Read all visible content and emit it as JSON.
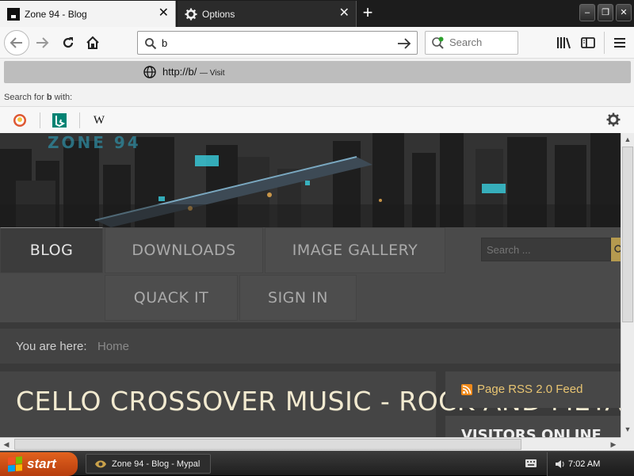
{
  "browser": {
    "tabs": [
      {
        "title": "Zone 94 - Blog",
        "active": true
      },
      {
        "title": "Options",
        "active": false
      }
    ],
    "new_tab_label": "+",
    "window_controls": {
      "minimize": "–",
      "maximize": "❐",
      "close": "✕"
    },
    "url_value": "b",
    "search_placeholder": "Search",
    "dropdown": {
      "suggestion_url": "http://b/",
      "suggestion_action": "— Visit",
      "search_for_prefix": "Search for",
      "search_for_term": "b",
      "search_for_suffix": "with:",
      "engines": [
        "duckduckgo-icon",
        "bing-icon",
        "wikipedia-icon"
      ]
    }
  },
  "site": {
    "logo": "ZONE 94",
    "menu": [
      "BLOG",
      "DOWNLOADS",
      "IMAGE GALLERY",
      "QUACK IT",
      "SIGN IN"
    ],
    "active_menu": "BLOG",
    "search_placeholder": "Search ...",
    "breadcrumb_label": "You are here:",
    "breadcrumb_home": "Home",
    "article_title": "CELLO CROSSOVER MUSIC - ROCK AND METAL",
    "rss_label": "Page RSS 2.0 Feed",
    "visitors_label": "VISITORS ONLINE"
  },
  "taskbar": {
    "start_label": "start",
    "task_title": "Zone 94 - Blog - Mypal",
    "clock": "7:02 AM"
  },
  "colors": {
    "accent_gold": "#e9c572",
    "title_cream": "#f2ead0",
    "start_orange": "#d9561a"
  }
}
